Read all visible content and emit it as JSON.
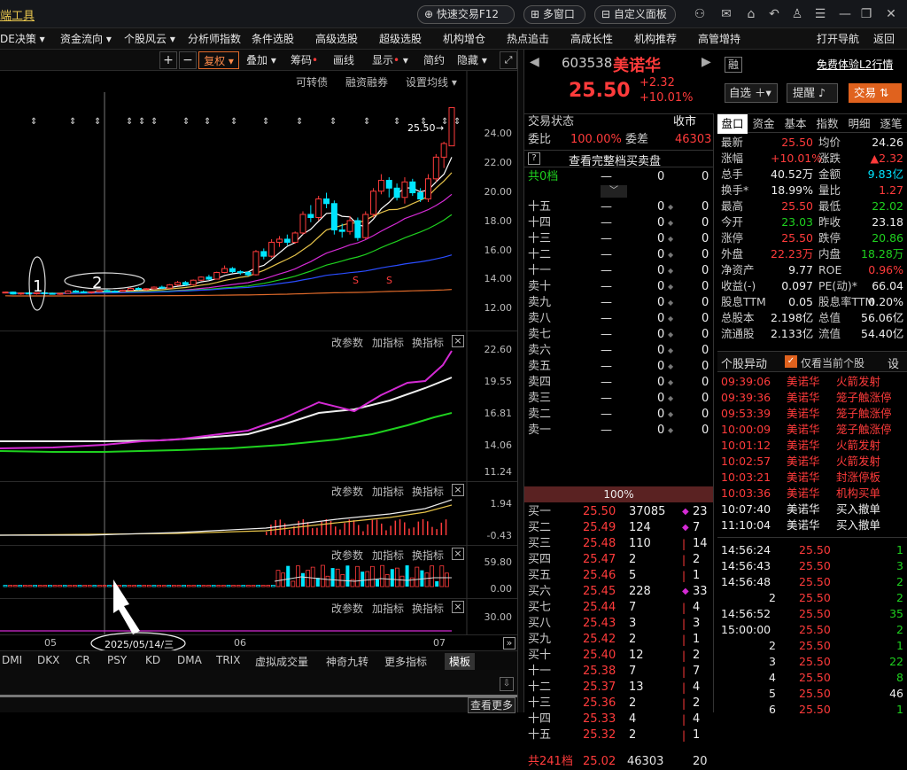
{
  "topbar": {
    "app_title": "端工具",
    "quick_trade": "快速交易F12",
    "multi_window": "多窗口",
    "custom_panel": "自定义面板"
  },
  "menu": [
    "DE决策 ▾",
    "资金流向 ▾",
    "个股风云 ▾",
    "分析师指数",
    "条件选股",
    "高级选股",
    "超级选股",
    "机构增仓",
    "热点追击",
    "高成长性",
    "机构推荐",
    "高管增持"
  ],
  "menu_right": {
    "open_nav": "打开导航",
    "back": "返回"
  },
  "chart_toolbar": {
    "plus": "+",
    "minus": "−",
    "fuquan": "复权",
    "overlay": "叠加",
    "chips": "筹码",
    "drawline": "画线",
    "display": "显示",
    "simple": "简约",
    "hide": "隐藏"
  },
  "main_links": {
    "convertible": "可转债",
    "margin": "融资融券",
    "setup_ma": "设置均线"
  },
  "price_axis": [
    "24.00",
    "22.00",
    "20.00",
    "18.00",
    "16.00",
    "14.00",
    "12.00"
  ],
  "last_price_tag": "25.50",
  "panels": [
    {
      "axis": [
        "22.60",
        "19.55",
        "16.81",
        "14.06",
        "11.24"
      ]
    },
    {
      "axis": [
        "1.94",
        "-0.43"
      ]
    },
    {
      "axis": [
        "59.80",
        "0.00"
      ]
    },
    {
      "axis": [
        "30.00"
      ]
    }
  ],
  "panel_actions": {
    "change_params": "改参数",
    "add_indicator": "加指标",
    "switch_indicator": "换指标",
    "close": "×"
  },
  "annotations": {
    "one": "1",
    "two": "2"
  },
  "date_axis": {
    "m05": "05",
    "cursor": "2025/05/14/三",
    "m06": "06",
    "m07": "07"
  },
  "indicator_tabs": [
    "DMI",
    "DKX",
    "CR",
    "PSY",
    "KD",
    "DMA",
    "TRIX",
    "虚拟成交量",
    "神奇九转",
    "更多指标",
    "模板"
  ],
  "chart_data": {
    "type": "candlestick",
    "ylim": [
      11.5,
      26.5
    ],
    "candles": [
      [
        13.55,
        13.62,
        13.5,
        13.58
      ],
      [
        13.58,
        13.62,
        13.42,
        13.46
      ],
      [
        13.46,
        13.55,
        13.4,
        13.52
      ],
      [
        13.52,
        13.58,
        13.44,
        13.48
      ],
      [
        13.48,
        13.56,
        13.42,
        13.54
      ],
      [
        13.54,
        13.6,
        13.47,
        13.5
      ],
      [
        13.5,
        13.55,
        13.42,
        13.46
      ],
      [
        13.46,
        13.52,
        13.4,
        13.5
      ],
      [
        13.5,
        13.7,
        13.48,
        13.65
      ],
      [
        13.65,
        13.72,
        13.55,
        13.6
      ],
      [
        13.6,
        13.68,
        13.52,
        13.56
      ],
      [
        13.56,
        13.62,
        13.48,
        13.6
      ],
      [
        13.6,
        13.7,
        13.55,
        13.68
      ],
      [
        13.68,
        13.75,
        13.6,
        13.64
      ],
      [
        13.64,
        13.7,
        13.56,
        13.62
      ],
      [
        13.62,
        13.74,
        13.58,
        13.7
      ],
      [
        13.7,
        13.86,
        13.66,
        13.82
      ],
      [
        13.82,
        13.9,
        13.7,
        13.75
      ],
      [
        13.75,
        13.84,
        13.68,
        13.8
      ],
      [
        13.8,
        13.95,
        13.76,
        13.9
      ],
      [
        13.9,
        14.0,
        13.78,
        13.84
      ],
      [
        13.84,
        14.1,
        13.8,
        14.05
      ],
      [
        14.05,
        14.3,
        13.98,
        14.2
      ],
      [
        14.2,
        14.3,
        14.0,
        14.06
      ],
      [
        14.06,
        14.4,
        14.0,
        14.35
      ],
      [
        14.35,
        14.6,
        14.3,
        14.55
      ],
      [
        14.55,
        14.7,
        14.35,
        14.42
      ],
      [
        14.42,
        14.9,
        14.4,
        14.85
      ],
      [
        14.85,
        15.3,
        14.8,
        15.1
      ],
      [
        15.1,
        15.2,
        14.82,
        14.9
      ],
      [
        14.9,
        15.0,
        14.7,
        14.85
      ],
      [
        14.85,
        14.95,
        14.6,
        14.7
      ],
      [
        14.7,
        16.3,
        14.65,
        16.2
      ],
      [
        16.2,
        16.4,
        15.7,
        15.9
      ],
      [
        15.9,
        17.0,
        15.8,
        16.8
      ],
      [
        16.8,
        17.2,
        16.5,
        17.0
      ],
      [
        17.0,
        17.3,
        16.6,
        16.8
      ],
      [
        16.8,
        17.5,
        16.7,
        17.4
      ],
      [
        17.4,
        18.8,
        17.3,
        18.6
      ],
      [
        18.6,
        19.2,
        18.1,
        18.4
      ],
      [
        18.4,
        19.8,
        18.2,
        19.6
      ],
      [
        19.6,
        20.0,
        19.0,
        19.3
      ],
      [
        19.3,
        19.5,
        17.3,
        17.6
      ],
      [
        17.6,
        18.0,
        17.1,
        17.5
      ],
      [
        17.5,
        18.5,
        17.3,
        18.2
      ],
      [
        18.2,
        18.4,
        16.9,
        17.1
      ],
      [
        17.1,
        18.8,
        17.0,
        18.6
      ],
      [
        18.6,
        20.3,
        18.4,
        20.1
      ],
      [
        20.1,
        21.2,
        19.9,
        20.8
      ],
      [
        20.8,
        21.0,
        19.7,
        20.3
      ],
      [
        20.3,
        20.6,
        19.5,
        19.7
      ],
      [
        19.7,
        21.0,
        19.3,
        20.7
      ],
      [
        20.7,
        20.9,
        19.8,
        20.0
      ],
      [
        20.0,
        20.3,
        19.4,
        19.6
      ],
      [
        19.6,
        21.2,
        19.4,
        20.9
      ],
      [
        20.9,
        22.5,
        20.7,
        22.3
      ],
      [
        22.3,
        23.3,
        21.6,
        23.18
      ],
      [
        23.03,
        25.5,
        23.03,
        25.5
      ]
    ]
  },
  "quote": {
    "code": "603538",
    "name": "美诺华",
    "price": "25.50",
    "change": "+2.32",
    "pct": "+10.01%",
    "rong": "融",
    "free_l2": "免费体验L2行情",
    "zixuan": "自选",
    "remind": "提醒",
    "trade": "交易"
  },
  "book_header": {
    "status_label": "交易状态",
    "status": "收市",
    "weibi_label": "委比",
    "weibi": "100.00%",
    "weicha_label": "委差",
    "weicha": "46303",
    "full_queue": "查看完整档买卖盘",
    "gong0": "共0档",
    "pct100": "100%"
  },
  "sells": [
    [
      "十五",
      "—",
      "0",
      "0"
    ],
    [
      "十四",
      "—",
      "0",
      "0"
    ],
    [
      "十三",
      "—",
      "0",
      "0"
    ],
    [
      "十二",
      "—",
      "0",
      "0"
    ],
    [
      "十一",
      "—",
      "0",
      "0"
    ],
    [
      "卖十",
      "—",
      "0",
      "0"
    ],
    [
      "卖九",
      "—",
      "0",
      "0"
    ],
    [
      "卖八",
      "—",
      "0",
      "0"
    ],
    [
      "卖七",
      "—",
      "0",
      "0"
    ],
    [
      "卖六",
      "—",
      "0",
      "0"
    ],
    [
      "卖五",
      "—",
      "0",
      "0"
    ],
    [
      "卖四",
      "—",
      "0",
      "0"
    ],
    [
      "卖三",
      "—",
      "0",
      "0"
    ],
    [
      "卖二",
      "—",
      "0",
      "0"
    ],
    [
      "卖一",
      "—",
      "0",
      "0"
    ]
  ],
  "buys": [
    [
      "买一",
      "25.50",
      "37085",
      "23"
    ],
    [
      "买二",
      "25.49",
      "124",
      "7"
    ],
    [
      "买三",
      "25.48",
      "110",
      "14"
    ],
    [
      "买四",
      "25.47",
      "2",
      "2"
    ],
    [
      "买五",
      "25.46",
      "5",
      "1"
    ],
    [
      "买六",
      "25.45",
      "228",
      "33"
    ],
    [
      "买七",
      "25.44",
      "7",
      "4"
    ],
    [
      "买八",
      "25.43",
      "3",
      "3"
    ],
    [
      "买九",
      "25.42",
      "2",
      "1"
    ],
    [
      "买十",
      "25.40",
      "12",
      "2"
    ],
    [
      "十一",
      "25.38",
      "7",
      "7"
    ],
    [
      "十二",
      "25.37",
      "13",
      "4"
    ],
    [
      "十三",
      "25.36",
      "2",
      "2"
    ],
    [
      "十四",
      "25.33",
      "4",
      "4"
    ],
    [
      "十五",
      "25.32",
      "2",
      "1"
    ]
  ],
  "buy_footer": {
    "label": "共241档",
    "price": "25.02",
    "vol": "46303",
    "n": "20"
  },
  "info_tabs": [
    "盘口",
    "资金",
    "基本",
    "指数",
    "明细",
    "逐笔"
  ],
  "stats": [
    [
      "最新",
      "25.50",
      "均价",
      "24.26"
    ],
    [
      "涨幅",
      "+10.01%",
      "涨跌",
      "▲2.32"
    ],
    [
      "总手",
      "40.52万",
      "金额",
      "9.83亿"
    ],
    [
      "换手*",
      "18.99%",
      "量比",
      "1.27"
    ],
    [
      "最高",
      "25.50",
      "最低",
      "22.02"
    ],
    [
      "今开",
      "23.03",
      "昨收",
      "23.18"
    ],
    [
      "涨停",
      "25.50",
      "跌停",
      "20.86"
    ],
    [
      "外盘",
      "22.23万",
      "内盘",
      "18.28万"
    ],
    [
      "净资产",
      "9.77",
      "ROE",
      "0.96%"
    ],
    [
      "收益(-)",
      "0.097",
      "PE(动)*",
      "66.04"
    ],
    [
      "股息TTM",
      "0.05",
      "股息率TTM",
      "0.20%"
    ],
    [
      "总股本",
      "2.198亿",
      "总值",
      "56.06亿"
    ],
    [
      "流通股",
      "2.133亿",
      "流值",
      "54.40亿"
    ]
  ],
  "anomaly": {
    "title": "个股异动",
    "only_current": "仅看当前个股",
    "settings": "设",
    "rows": [
      [
        "09:39:06",
        "美诺华",
        "火箭发射"
      ],
      [
        "09:39:36",
        "美诺华",
        "笼子触涨停"
      ],
      [
        "09:53:39",
        "美诺华",
        "笼子触涨停"
      ],
      [
        "10:00:09",
        "美诺华",
        "笼子触涨停"
      ],
      [
        "10:01:12",
        "美诺华",
        "火箭发射"
      ],
      [
        "10:02:57",
        "美诺华",
        "火箭发射"
      ],
      [
        "10:03:21",
        "美诺华",
        "封涨停板"
      ],
      [
        "10:03:36",
        "美诺华",
        "机构买单"
      ],
      [
        "10:07:40",
        "美诺华",
        "买入撤单"
      ],
      [
        "11:10:04",
        "美诺华",
        "买入撤单"
      ]
    ]
  },
  "ticks": [
    [
      "14:56:24",
      "25.50",
      "1"
    ],
    [
      "14:56:43",
      "25.50",
      "3"
    ],
    [
      "14:56:48",
      "25.50",
      "2"
    ],
    [
      "2",
      "25.50",
      "2"
    ],
    [
      "14:56:52",
      "25.50",
      "35"
    ],
    [
      "15:00:00",
      "25.50",
      "2"
    ],
    [
      "2",
      "25.50",
      "1"
    ],
    [
      "3",
      "25.50",
      "22"
    ],
    [
      "4",
      "25.50",
      "8"
    ],
    [
      "5",
      "25.50",
      "46"
    ],
    [
      "6",
      "25.50",
      "1"
    ]
  ],
  "see_more": "查看更多"
}
